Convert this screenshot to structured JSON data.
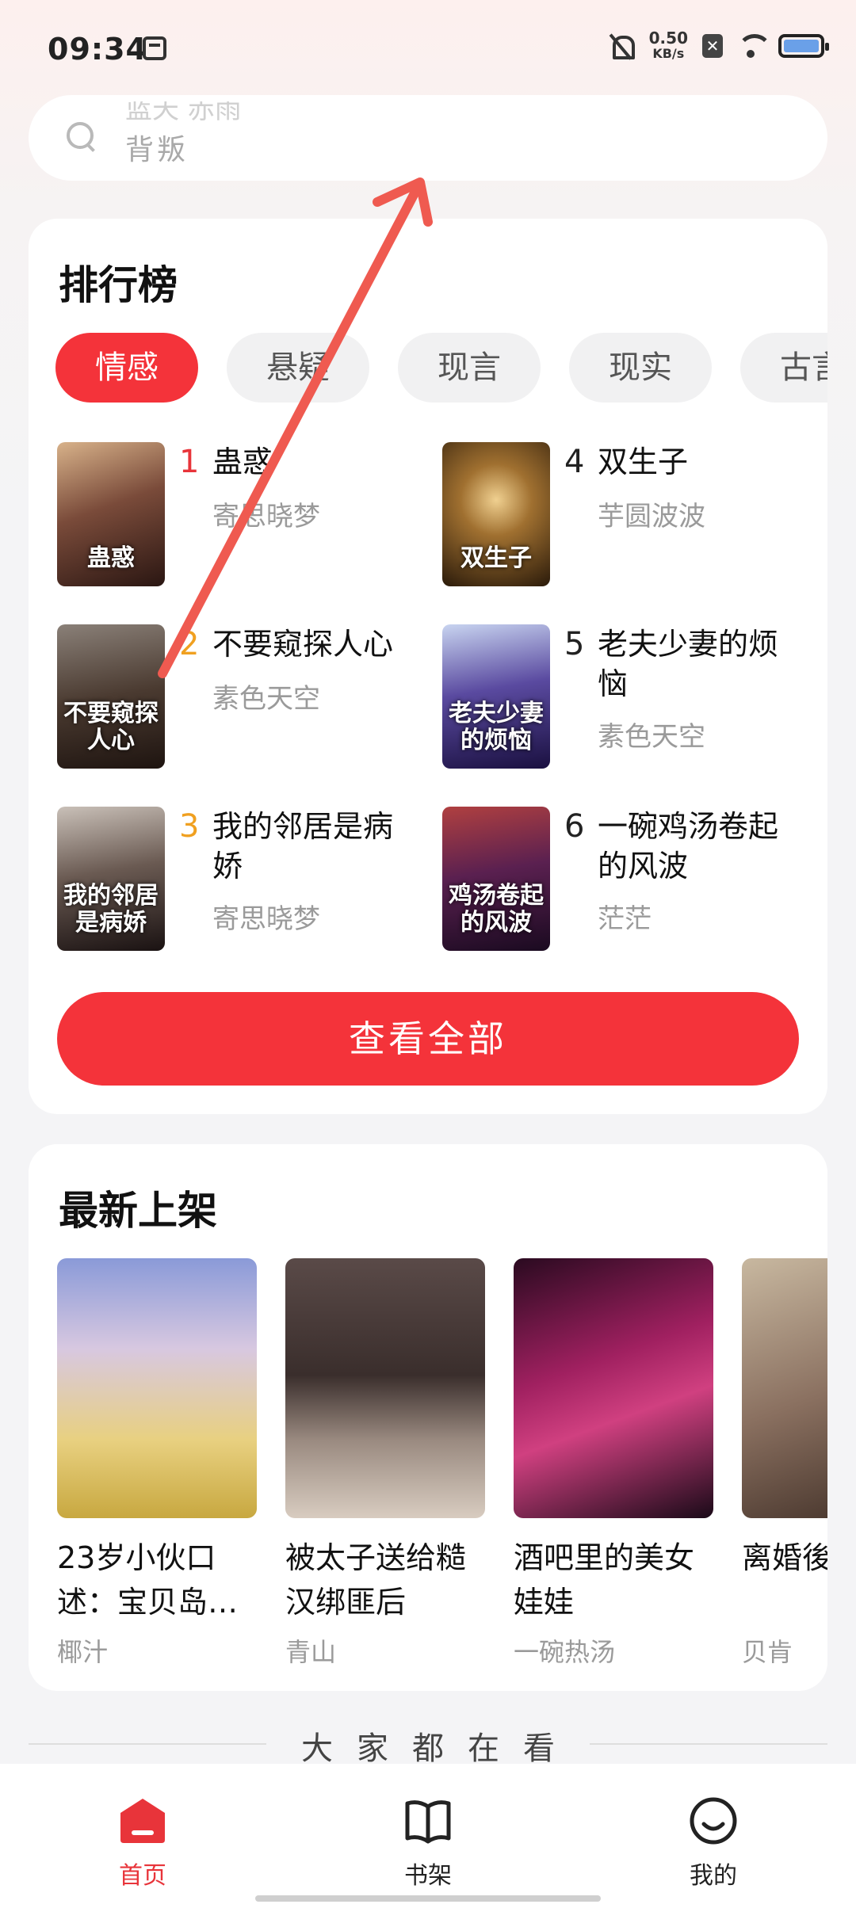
{
  "status_bar": {
    "time": "09:34",
    "net_speed_value": "0.50",
    "net_speed_unit": "KB/s"
  },
  "search": {
    "prev_text": "蓝天 赤雨",
    "placeholder": "背叛"
  },
  "ranking": {
    "title": "排行榜",
    "tabs": [
      "情感",
      "悬疑",
      "现言",
      "现实",
      "古言"
    ],
    "active_tab": "情感",
    "items": [
      {
        "rank": "1",
        "title": "蛊惑",
        "author": "寄思晓梦",
        "cover_text": "蛊惑"
      },
      {
        "rank": "2",
        "title": "不要窥探人心",
        "author": "素色天空",
        "cover_text": "不要窥探人心"
      },
      {
        "rank": "3",
        "title": "我的邻居是病娇",
        "author": "寄思晓梦",
        "cover_text": "我的邻居是病娇"
      },
      {
        "rank": "4",
        "title": "双生子",
        "author": "芋圆波波",
        "cover_text": "双生子"
      },
      {
        "rank": "5",
        "title": "老夫少妻的烦恼",
        "author": "素色天空",
        "cover_text": "老夫少妻的烦恼"
      },
      {
        "rank": "6",
        "title": "一碗鸡汤卷起的风波",
        "author": "茫茫",
        "cover_text": "鸡汤卷起的风波"
      }
    ],
    "view_all": "查看全部"
  },
  "newest": {
    "title": "最新上架",
    "items": [
      {
        "title": "23岁小伙口述：宝贝岛…",
        "author": "椰汁"
      },
      {
        "title": "被太子送给糙汉绑匪后",
        "author": "青山"
      },
      {
        "title": "酒吧里的美女娃娃",
        "author": "一碗热汤"
      },
      {
        "title": "离婚後户艳遇",
        "author": "贝肯"
      }
    ]
  },
  "everyone_watching": "大家都在看",
  "bottom_nav": {
    "items": [
      {
        "label": "首页",
        "icon": "home-book-icon",
        "active": true
      },
      {
        "label": "书架",
        "icon": "open-book-icon",
        "active": false
      },
      {
        "label": "我的",
        "icon": "smiley-face-icon",
        "active": false
      }
    ]
  },
  "colors": {
    "accent": "#f4333a",
    "annotation_arrow": "#ef5a50"
  }
}
